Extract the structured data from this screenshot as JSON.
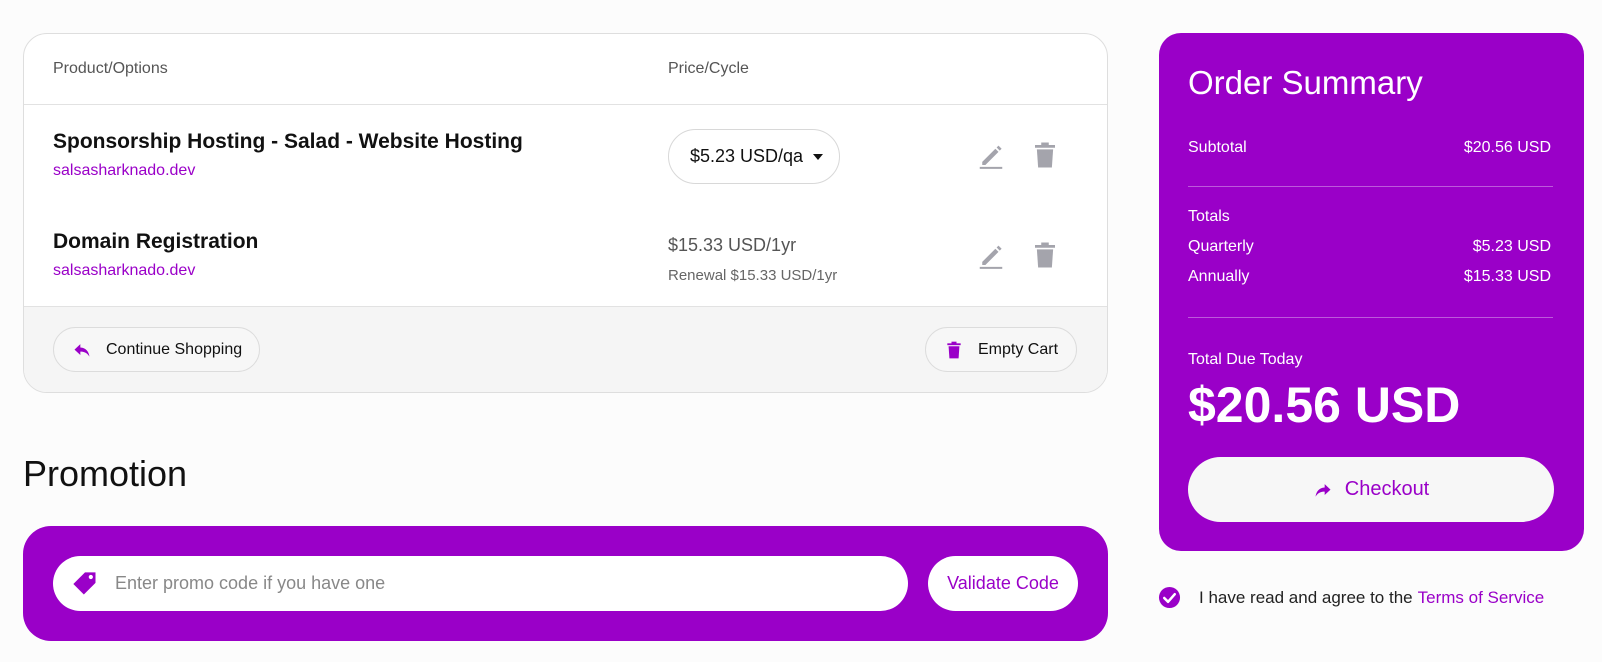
{
  "cart": {
    "headers": {
      "product": "Product/Options",
      "price": "Price/Cycle"
    },
    "items": [
      {
        "name": "Sponsorship Hosting - Salad - Website Hosting",
        "domain": "salsasharknado.dev",
        "cycle_selected": "$5.23 USD/qa"
      },
      {
        "name": "Domain Registration",
        "domain": "salsasharknado.dev",
        "price": "$15.33 USD/1yr",
        "renewal": "Renewal $15.33 USD/1yr"
      }
    ],
    "continue_label": "Continue Shopping",
    "empty_label": "Empty Cart"
  },
  "promotion": {
    "title": "Promotion",
    "placeholder": "Enter promo code if you have one",
    "validate_label": "Validate Code"
  },
  "summary": {
    "title": "Order Summary",
    "subtotal_label": "Subtotal",
    "subtotal_value": "$20.56 USD",
    "totals_label": "Totals",
    "quarterly_label": "Quarterly",
    "quarterly_value": "$5.23 USD",
    "annually_label": "Annually",
    "annually_value": "$15.33 USD",
    "total_due_label": "Total Due Today",
    "total_due_value": "$20.56 USD",
    "checkout_label": "Checkout"
  },
  "tos": {
    "text": "I have read and agree to the",
    "link": "Terms of Service",
    "checked": true
  },
  "colors": {
    "accent": "#9a00c8",
    "icon_gray": "#a4a4ac"
  },
  "icons": [
    "edit-icon",
    "trash-icon",
    "reply-icon",
    "tag-icon",
    "share-arrow-icon",
    "check-circle-icon"
  ]
}
